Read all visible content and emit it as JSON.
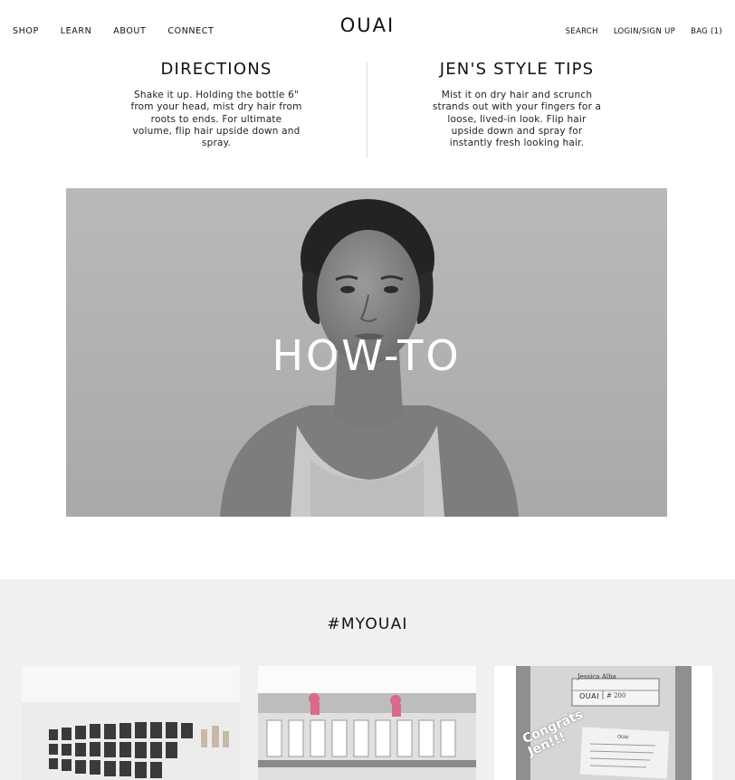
{
  "header": {
    "nav_left": [
      "SHOP",
      "LEARN",
      "ABOUT",
      "CONNECT"
    ],
    "logo": "OUAI",
    "nav_right": [
      "SEARCH",
      "LOGIN/SIGN UP",
      "BAG (1)"
    ]
  },
  "directions": {
    "title": "DIRECTIONS",
    "body": "Shake it up. Holding the bottle 6\" from your head, mist dry hair from roots to ends. For ultimate volume, flip hair upside down and spray."
  },
  "tips": {
    "title": "JEN'S STYLE TIPS",
    "body": "Mist it on dry hair and scrunch strands out with your fingers for a loose, lived-in look. Flip hair upside down and spray for instantly fresh looking hair."
  },
  "hero": {
    "title": "HOW-TO"
  },
  "myouai": {
    "title": "#MYOUAI",
    "card3": {
      "name": "Jessica Alba",
      "brand": "OUAI",
      "number": "# 200",
      "overlay": "Congrats Jen!!!"
    }
  },
  "colors": {
    "text": "#111111",
    "hero_bg": "#b3b3b3",
    "section_bg": "#f0f0f0",
    "divider": "#dcdcdc"
  }
}
